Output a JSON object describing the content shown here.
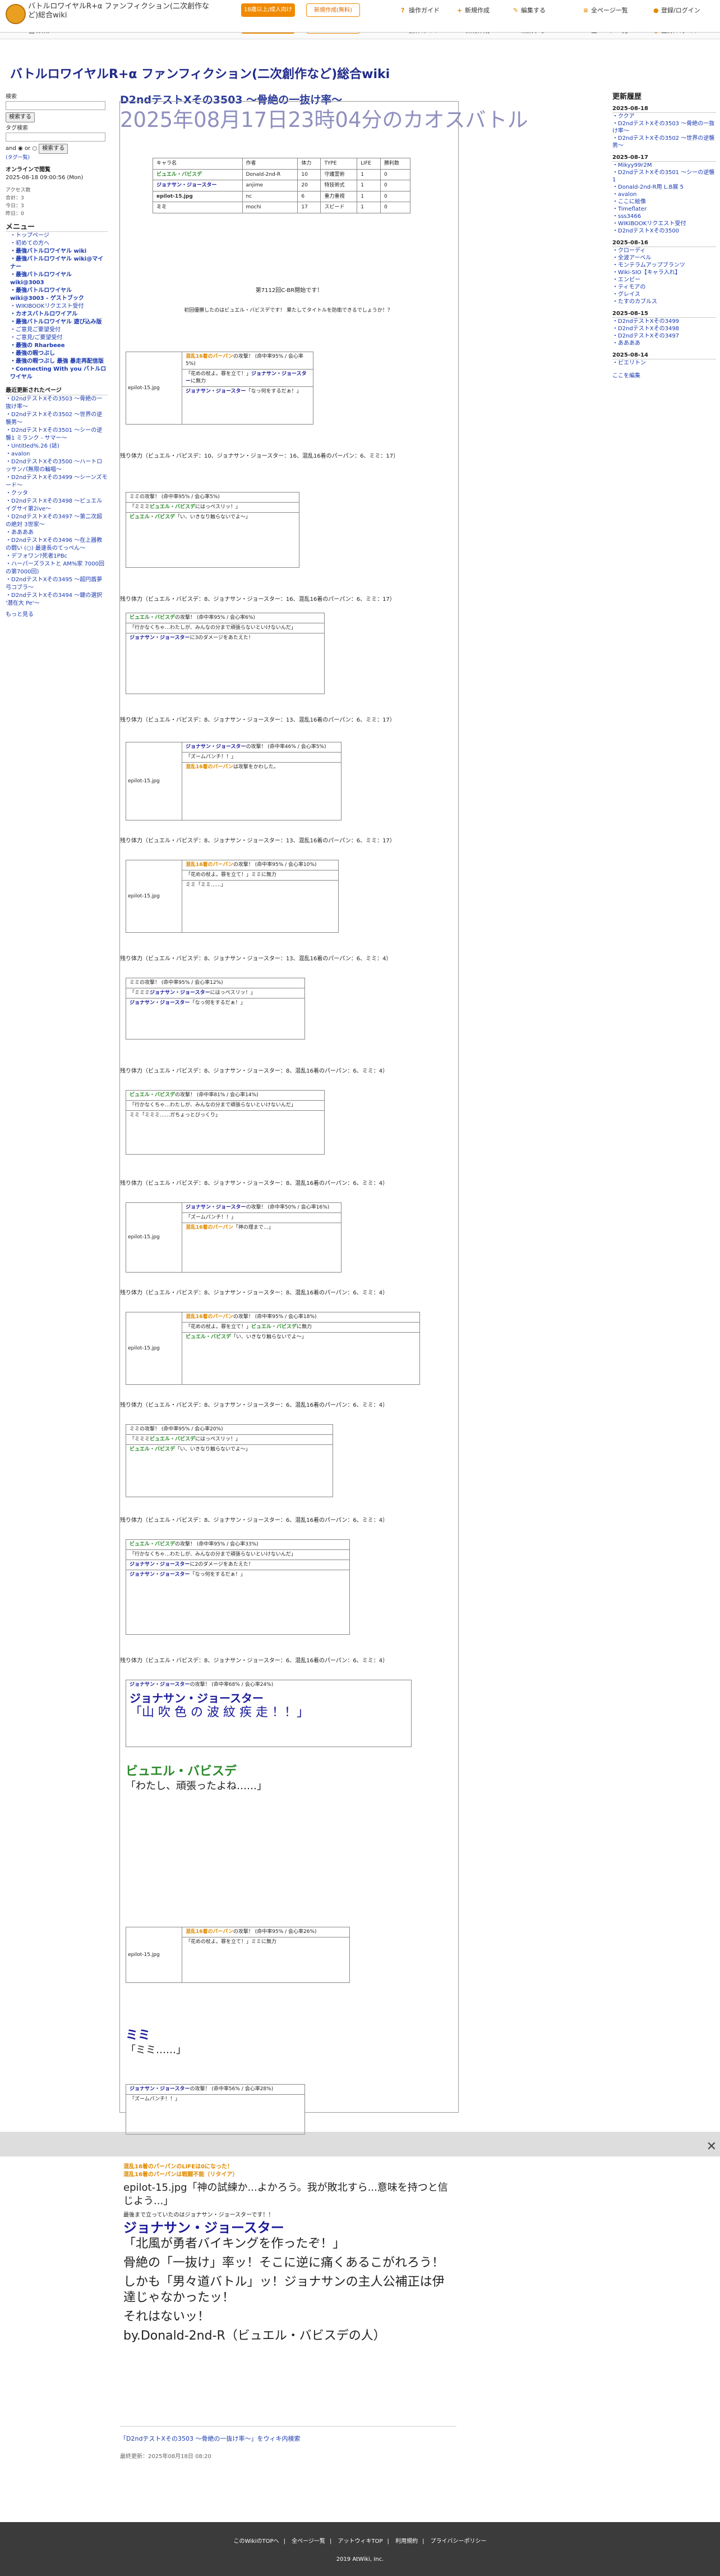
{
  "header": {
    "site_title": "バトルロワイヤルR+α ファンフィクション(二次創作など)総合wiki",
    "btn_adult": "18歳以上/成人向け",
    "btn_new": "新規作成(無料)",
    "nav": [
      "操作ガイド",
      "新規作成",
      "編集する",
      "全ページ一覧",
      "登録/ログイン"
    ]
  },
  "wiki_title": "バトルロワイヤルR+α ファンフィクション(二次創作など)総合wiki",
  "left": {
    "search_label": "検索",
    "search_btn": "検索する",
    "tagsearch_label": "タグ検索",
    "and": "and",
    "or": "or",
    "tagsearch_btn": "検索する",
    "tag_list": "(タグ一覧)",
    "online": "オンラインで閲覧",
    "online_date": "2025-08-18 09:00:56 (Mon)",
    "access": [
      "アクセス数",
      "合計：3",
      "今日：3",
      "昨日：0"
    ],
    "menu_h": "メニュー",
    "menu": [
      {
        "t": "トップページ",
        "b": false
      },
      {
        "t": "初めての方へ",
        "b": false
      },
      {
        "t": "最強バトルロワイヤル wiki",
        "b": true
      },
      {
        "t": "最強バトルロワイヤル wiki@マイナー",
        "b": true
      },
      {
        "t": "最強バトルロワイヤル wiki@3003",
        "b": true
      },
      {
        "t": "最強バトルロワイヤル wiki@3003 - ゲストブック",
        "b": true
      },
      {
        "t": "WIKIBOOKリクエスト受付",
        "b": false
      },
      {
        "t": "カオスバトルロワイアル",
        "b": true
      },
      {
        "t": "最強バトルロワイヤル 遊び込み版",
        "b": true
      },
      {
        "t": "ご意見ご要望受付",
        "b": false
      },
      {
        "t": "ご意見/ご要望受付",
        "b": false
      },
      {
        "t": "最強の Rharbeee",
        "b": true
      },
      {
        "t": "最強の暇つぶし",
        "b": true
      },
      {
        "t": "最強の暇つぶし 最強 暴走再配信版",
        "b": true
      },
      {
        "t": "Connecting With you バトルロワイヤル",
        "b": true
      }
    ],
    "history_h": "最近更新されたページ",
    "history": [
      "D2ndテストXその3503 〜骨絶の一抜け率〜",
      "D2ndテストXその3502 〜世界の逆襲男〜",
      "D2ndテストXその3501 〜シーの逆襲1 ミランク - サマー〜",
      "Untitled%.26 (誌)",
      "avalon",
      "D2ndテストXその3500 〜ハートロッサンパ無限の輪唱〜",
      "D2ndテストXその3499 〜シーンズモード〜",
      "クッタ",
      "D2ndテストXその3498 〜ビュエルイグサイ第2ive〜",
      "D2ndテストXその3497 〜第二次超の絶対 3世家〜",
      "ああああ",
      "D2ndテストXその3496 〜在上器教の闘い (○) 最速長のてっぺん〜",
      "デフォワン?死者1PBc",
      "ハーパーズラストと AM%家 7000回の第7000回)",
      "D2ndテストXその3495 〜超円盾夢弓コブラ〜",
      "D2ndテストXその3494 〜鍵の選択 '潜在大 Pe'〜"
    ],
    "more": "もっと見る"
  },
  "page": {
    "title": "D2ndテストXその3503 〜骨絶の一抜け率〜",
    "subtitle": "2025年08月17日23時04分のカオスバトル"
  },
  "entry": {
    "table_head": [
      "キャラ名",
      "作者",
      "体力",
      "TYPE",
      "LIFE",
      "勝利数"
    ],
    "table_rows": [
      [
        "ビュエル・バビスデ",
        "Donald-2nd-R",
        "10",
        "守護霊術",
        "1",
        "0"
      ],
      [
        "ジョナサン・ジョースター",
        "anjime",
        "20",
        "特技術式",
        "1",
        "0"
      ],
      [
        "epilot-15.jpg",
        "nc",
        "6",
        "重力重視",
        "1",
        "0"
      ],
      [
        "ミミ",
        "mochi",
        "17",
        "スピード",
        "1",
        "0"
      ]
    ],
    "intro_1": "第7112回C-BR開始です！",
    "intro_2": "初回優勝したのはビュエル・バビスデです！ 果たしてタイトルを防衛できるでしょうか！？",
    "rounds": [
      {
        "remain": "残り体力（ビュエル・バビスデ：10、ジョナサン・ジョースター：16、混乱16着のパーパン：6、ミミ：17）"
      },
      {
        "remain": "残り体力（ビュエル・バビスデ：8、ジョナサン・ジョースター：16、混乱16着のパーパン：6、ミミ：17）"
      },
      {
        "remain": "残り体力（ビュエル・バビスデ：8、ジョナサン・ジョースター：13、混乱16着のパーパン：6、ミミ：17）"
      },
      {
        "remain": "残り体力（ビュエル・バビスデ：8、ジョナサン・ジョースター：13、混乱16着のパーパン：6、ミミ：17）"
      },
      {
        "remain": "残り体力（ビュエル・バビスデ：8、ジョナサン・ジョースター：13、混乱16着のパーパン：6、ミミ：4）"
      },
      {
        "remain": "残り体力（ビュエル・バビスデ：8、ジョナサン・ジョースター：8、混乱16着のパーパン：6、ミミ：4）"
      },
      {
        "remain": "残り体力（ビュエル・バビスデ：8、ジョナサン・ジョースター：8、混乱16着のパーパン：6、ミミ：4）"
      },
      {
        "remain": "残り体力（ビュエル・バビスデ：8、ジョナサン・ジョースター：8、混乱16着のパーパン：6、ミミ：4）"
      },
      {
        "remain": "残り体力（ビュエル・バビスデ：8、ジョナサン・ジョースター：6、混乱16着のパーパン：6、ミミ：4）"
      },
      {
        "remain": "残り体力（ビュエル・バビスデ：8、ジョナサン・ジョースター：6、混乱16着のパーパン：6、ミミ：4）"
      },
      {
        "remain": "残り体力（ビュエル・バビスデ：8、ジョナサン・ジョースター：6、混乱16着のパーパン：6、ミミ：4）"
      }
    ],
    "special_quote": "「山 吹 色 の 波 紋 疾 走 ！！」",
    "special_name": "ジョナサン・ジョースター",
    "bye_name": "ビュエル・バビスデ",
    "bye_quote": "「わたし、頑張ったよね……」",
    "mimi_name": "ミミ",
    "mimi_quote": "「ミミ……」"
  },
  "finale": {
    "lines": [
      "混乱16着のパーパンのLIFEは0になった！",
      "混乱16着のパーパンは戦闘不能（リタイア）",
      "最後まで立っていたのはジョナサン・ジョースターです！！",
      "「北風が勇者バイキングを作ったぞ！」",
      "骨絶の「一抜け」率ッ！そこに逆に痛くあるこがれろう！",
      "しかも「男々道バトル」ッ！ジョナサンの主人公補正は伊達じゃなかったッ！",
      "それはないッ！",
      "by.Donald-2nd-R（ビュエル・バビスデの人）"
    ],
    "winner_name": "ジョナサン・ジョースター",
    "img_alt": "epilot-15.jpg「神の試練か...よかろう。我が敗北すら...意味を持つと信じよう...」"
  },
  "footer_link": "「D2ndテストXその3503 〜骨絶の一抜け率〜」をウィキ内検索",
  "footer_updated": "最終更新：2025年08月18日 08:20",
  "footer": {
    "links": [
      "このWikiのTOPへ",
      "全ページ一覧",
      "アットウィキTOP",
      "利用規約",
      "プライバシーポリシー"
    ],
    "copy": "2019 AtWiki, Inc."
  },
  "right": {
    "h": "更新履歴",
    "dates": [
      {
        "d": "2025-08-18",
        "items": [
          "ククア",
          "D2ndテストXその3503 〜骨絶の一抜け率〜",
          "D2ndテストXその3502 〜世界の逆襲男〜"
        ]
      },
      {
        "d": "2025-08-17",
        "items": [
          "Mikyy99r2M",
          "D2ndテストXその3501 〜シーの逆襲1",
          "Donald-2nd-R用 L.B展 5",
          "avalon",
          "ここに絵像",
          "Timeflater",
          "sss3466",
          "WIKIBOOKリクエスト受付",
          "D2ndテストXその3500"
        ]
      },
      {
        "d": "2025-08-16",
        "items": [
          "クローディ",
          "全波アーベル",
          "モンテラムアップブランツ",
          "Wiki-SIO【キャラ入れ】",
          "エンピー",
          "ティモアの",
          "グレイス",
          "たすのカブルス"
        ]
      },
      {
        "d": "2025-08-15",
        "items": [
          "D2ndテストXその3499",
          "D2ndテストXその3498",
          "D2ndテストXその3497",
          "ああああ"
        ]
      },
      {
        "d": "2025-08-14",
        "items": [
          "ビエリトン"
        ]
      }
    ],
    "more": "ここを編集"
  }
}
